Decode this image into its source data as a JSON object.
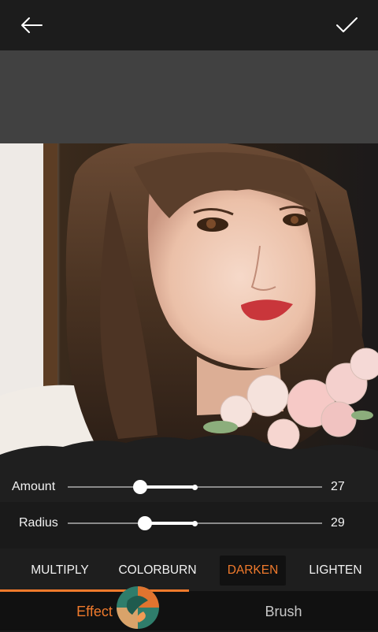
{
  "topbar": {
    "back_icon": "arrow-left-icon",
    "confirm_icon": "checkmark-icon"
  },
  "controls": {
    "amount": {
      "label": "Amount",
      "value": "27",
      "level": 0.27
    },
    "radius": {
      "label": "Radius",
      "value": "29",
      "level": 0.29
    }
  },
  "modes": {
    "items": [
      "MULTIPLY",
      "COLORBURN",
      "DARKEN",
      "LIGHTEN"
    ],
    "selected": "DARKEN"
  },
  "tabs": {
    "effect": "Effect",
    "brush": "Brush",
    "selected": "Effect"
  },
  "colors": {
    "accent": "#f07a2c",
    "background": "#1a1a1a",
    "strip": "#414141"
  }
}
